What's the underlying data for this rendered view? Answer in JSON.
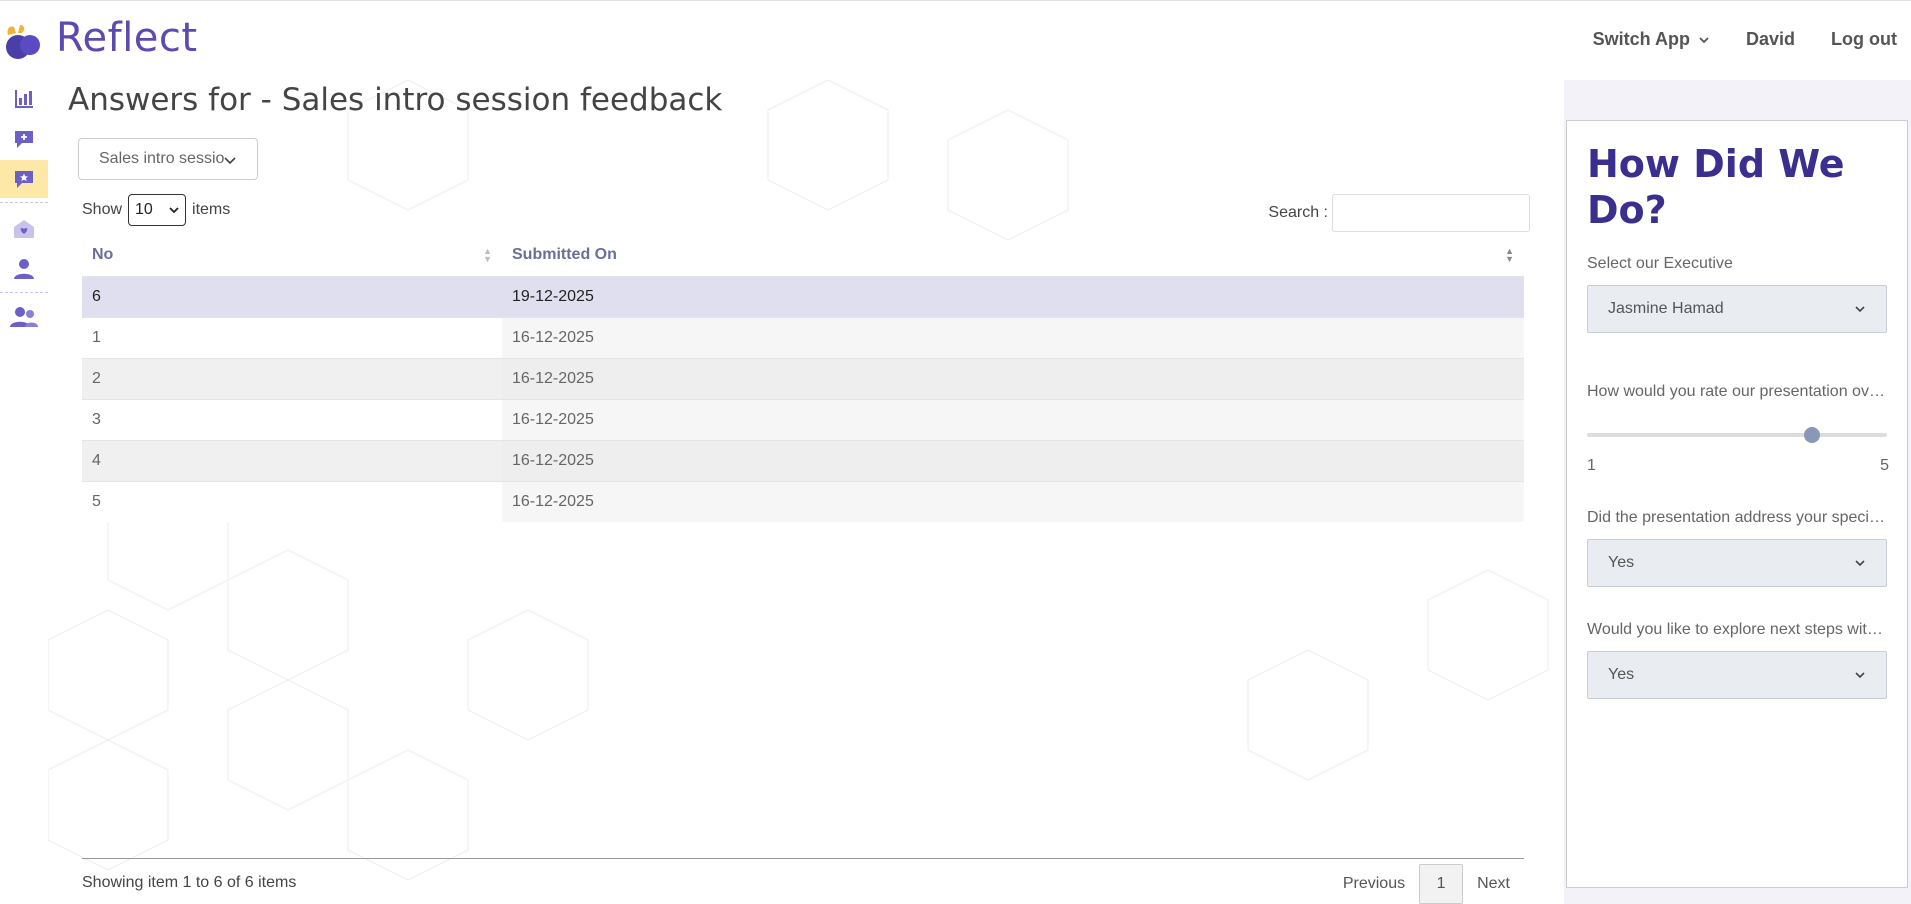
{
  "app": {
    "brand": "Reflect"
  },
  "nav": {
    "switch_app": "Switch App",
    "user": "David",
    "logout": "Log out"
  },
  "page": {
    "title": "Answers for - Sales intro session feedback"
  },
  "survey_selector": {
    "value": "Sales intro session feedback"
  },
  "table_controls": {
    "show_label": "Show",
    "page_size": "10",
    "items_label": "items",
    "search_label": "Search :",
    "search_value": ""
  },
  "table": {
    "headers": {
      "no": "No",
      "submitted_on": "Submitted On"
    },
    "rows": [
      {
        "no": "6",
        "date": "19-12-2025"
      },
      {
        "no": "1",
        "date": "16-12-2025"
      },
      {
        "no": "2",
        "date": "16-12-2025"
      },
      {
        "no": "3",
        "date": "16-12-2025"
      },
      {
        "no": "4",
        "date": "16-12-2025"
      },
      {
        "no": "5",
        "date": "16-12-2025"
      }
    ]
  },
  "footer": {
    "showing": "Showing item 1 to 6 of 6 items",
    "previous": "Previous",
    "current_page": "1",
    "next": "Next"
  },
  "preview": {
    "title": "How Did We Do?",
    "q1_label": "Select our Executive",
    "q1_value": "Jasmine Hamad",
    "q2_label": "How would you rate our presentation overall?",
    "q2_min": "1",
    "q2_max": "5",
    "q2_value": 4,
    "q3_label": "Did the presentation address your specific needs?",
    "q3_value": "Yes",
    "q4_label": "Would you like to explore next steps with us?",
    "q4_value": "Yes"
  },
  "colors": {
    "brand": "#5a4bb0",
    "accent_yellow": "#fde8a8",
    "selected_row": "#e0dff0",
    "preview_title": "#3a2e8f"
  },
  "icons": [
    "app-logo-icon",
    "chart-icon",
    "add-comment-icon",
    "star-comment-icon",
    "home-heart-icon",
    "user-icon",
    "users-icon",
    "chevron-down-icon"
  ]
}
